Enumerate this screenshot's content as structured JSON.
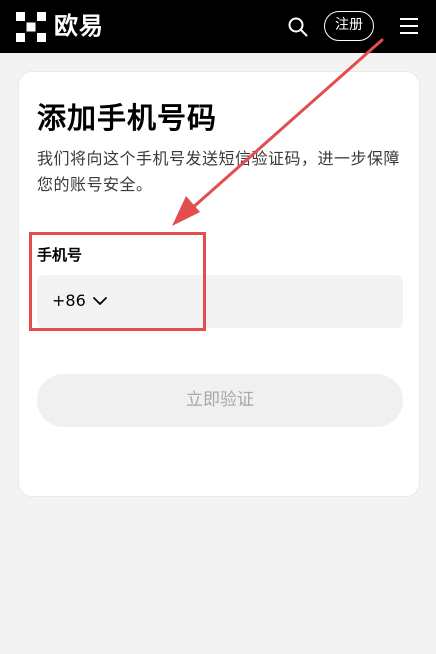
{
  "header": {
    "brand": "欧易",
    "register_label": "注册",
    "icons": [
      "okx-logo-icon",
      "search-icon",
      "menu-icon"
    ]
  },
  "card": {
    "title": "添加手机号码",
    "subtitle": "我们将向这个手机号发送短信验证码，进一步保障您的账号安全。",
    "phone_label": "手机号",
    "country_code": "+86",
    "phone_value": "",
    "verify_label": "立即验证"
  },
  "colors": {
    "header_bg": "#000000",
    "page_bg": "#f3f3f3",
    "annotation": "#e24d4d",
    "disabled_text": "#a8a8a8"
  }
}
